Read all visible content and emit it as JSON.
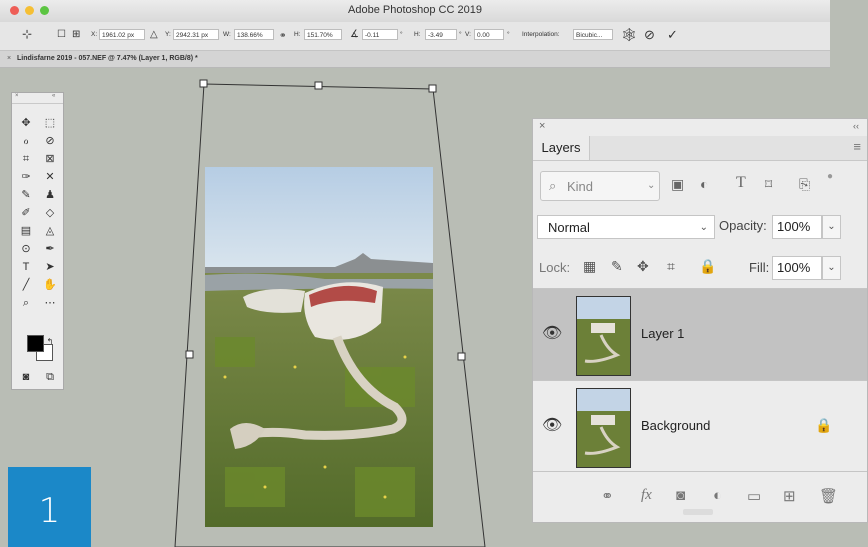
{
  "app": {
    "title": "Adobe Photoshop CC 2019"
  },
  "options_bar": {
    "x_label": "X:",
    "x_value": "1961.02 px",
    "y_label": "Y:",
    "y_value": "2942.31 px",
    "w_label": "W:",
    "w_value": "138.66%",
    "h_label": "H:",
    "h_value": "151.70%",
    "angle_value": "-0.11",
    "skew_h_label": "H:",
    "skew_h_value": "-3.49",
    "skew_v_label": "V:",
    "skew_v_value": "0.00",
    "degree_symbol": "°",
    "interpolation_label": "Interpolation:",
    "interpolation_value": "Bicubic..."
  },
  "document_tab": {
    "close": "×",
    "title": "Lindisfarne 2019 - 057.NEF @ 7.47% (Layer 1, RGB/8) *"
  },
  "tools": {
    "icons": [
      "move-tool",
      "marquee-tool",
      "lasso-tool",
      "quick-select-tool",
      "crop-tool",
      "frame-tool",
      "eyedropper-tool",
      "healing-tool",
      "brush-tool",
      "stamp-tool",
      "history-brush-tool",
      "eraser-tool",
      "gradient-tool",
      "blur-tool",
      "dodge-tool",
      "pen-tool",
      "type-tool",
      "path-select-tool",
      "line-tool",
      "hand-tool",
      "zoom-tool",
      "more-tools"
    ],
    "foreground_color": "#000000",
    "background_color": "#ffffff"
  },
  "step_badge": {
    "number": "1",
    "color": "#1b88c8"
  },
  "layers_panel": {
    "close": "×",
    "collapse": "‹‹",
    "tab_label": "Layers",
    "filter_kind": "Kind",
    "blend_mode": "Normal",
    "opacity_label": "Opacity:",
    "opacity_value": "100%",
    "lock_label": "Lock:",
    "fill_label": "Fill:",
    "fill_value": "100%",
    "layers": [
      {
        "name": "Layer 1",
        "selected": true,
        "visible": true,
        "locked": false
      },
      {
        "name": "Background",
        "selected": false,
        "visible": true,
        "locked": true
      }
    ],
    "footer_fx": "fx"
  }
}
